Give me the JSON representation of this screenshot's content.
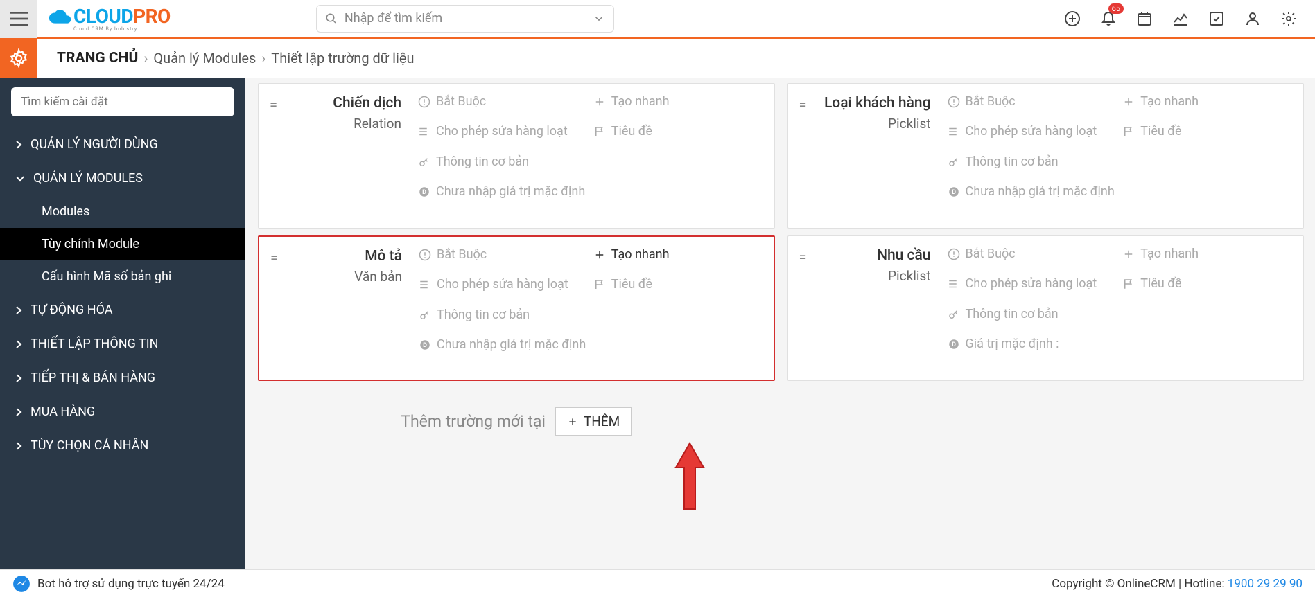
{
  "header": {
    "search_placeholder": "Nhập để tìm kiếm",
    "notification_count": "65"
  },
  "breadcrumb": {
    "home": "TRANG CHỦ",
    "l1": "Quản lý Modules",
    "l2": "Thiết lập trường dữ liệu"
  },
  "sidebar": {
    "search_placeholder": "Tìm kiếm cài đặt",
    "items": {
      "users": "QUẢN LÝ NGƯỜI DÙNG",
      "modules_mgmt": "QUẢN LÝ MODULES",
      "sub_modules": "Modules",
      "sub_customize": "Tùy chỉnh Module",
      "sub_numbering": "Cấu hình Mã số bản ghi",
      "automation": "TỰ ĐỘNG HÓA",
      "info": "THIẾT LẬP THÔNG TIN",
      "marketing": "TIẾP THỊ & BÁN HÀNG",
      "purchase": "MUA HÀNG",
      "personal": "TÙY CHỌN CÁ NHÂN"
    }
  },
  "fields": {
    "campaign": {
      "name": "Chiến dịch",
      "type": "Relation"
    },
    "description": {
      "name": "Mô tả",
      "type": "Văn bản"
    },
    "customer_type": {
      "name": "Loại khách hàng",
      "type": "Picklist"
    },
    "demand": {
      "name": "Nhu cầu",
      "type": "Picklist"
    }
  },
  "props": {
    "required": "Bắt Buộc",
    "quick_create": "Tạo nhanh",
    "mass_edit": "Cho phép sửa hàng loạt",
    "header": "Tiêu đề",
    "basic": "Thông tin cơ bản",
    "no_default": "Chưa nhập giá trị mặc định",
    "default_colon": "Giá trị mặc định :"
  },
  "add_row": {
    "label": "Thêm trường mới tại",
    "button": "THÊM"
  },
  "footer": {
    "bot": "Bot hỗ trợ sử dụng trực tuyến 24/24",
    "copyright": "Copyright © OnlineCRM",
    "hotline_label": "Hotline:",
    "hotline": "1900 29 29 90"
  }
}
